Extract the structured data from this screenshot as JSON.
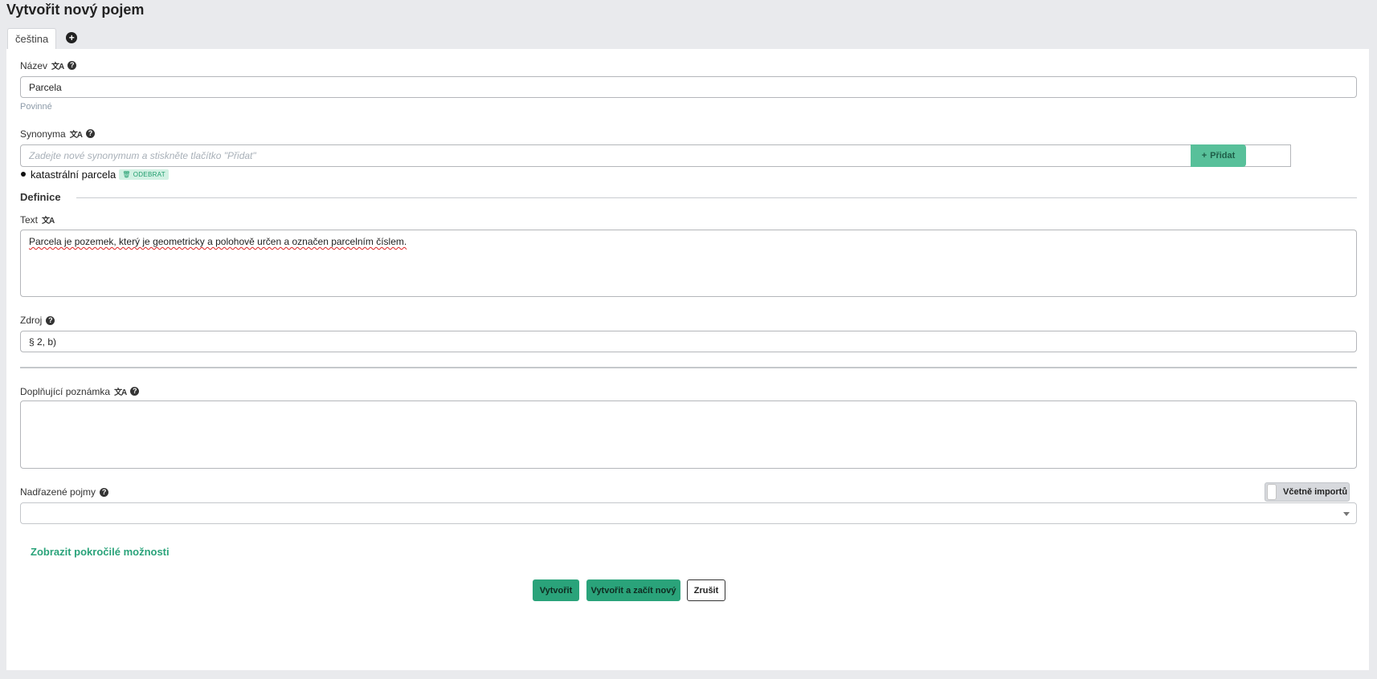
{
  "header": {
    "title": "Vytvořit nový pojem"
  },
  "tabs": [
    {
      "label": "čeština"
    }
  ],
  "icons": {
    "add_language": "plus-circle-icon",
    "translate": "translate-icon",
    "help": "question-circle-icon",
    "trash": "trash-icon",
    "caret": "chevron-down-icon"
  },
  "form": {
    "name": {
      "label": "Název",
      "value": "Parcela",
      "hint": "Povinné"
    },
    "synonyms": {
      "label": "Synonyma",
      "placeholder": "Zadejte nové synonymum a stiskněte tlačítko \"Přidat\"",
      "add_label": "Přidat",
      "items": [
        {
          "text": "katastrální parcela",
          "remove_label": "ODEBRAT"
        }
      ]
    },
    "definition": {
      "section_title": "Definice",
      "text_label": "Text",
      "text_value": "Parcela je pozemek, který je geometricky a polohově určen a označen parcelním číslem."
    },
    "source": {
      "label": "Zdroj",
      "value": "§ 2, b)"
    },
    "note": {
      "label": "Doplňující poznámka",
      "value": ""
    },
    "parent": {
      "label": "Nadřazené pojmy",
      "toggle_label": "Včetně importů",
      "toggle_on": false,
      "value": ""
    },
    "advanced_link": "Zobrazit pokročilé možnosti"
  },
  "actions": {
    "create": "Vytvořit",
    "create_and_new": "Vytvořit a začít nový",
    "cancel": "Zrušit"
  },
  "colors": {
    "accent": "#2aa37a",
    "add_button": "#58c09a",
    "badge_bg": "#d1f1e3",
    "background": "#e9eaed"
  }
}
